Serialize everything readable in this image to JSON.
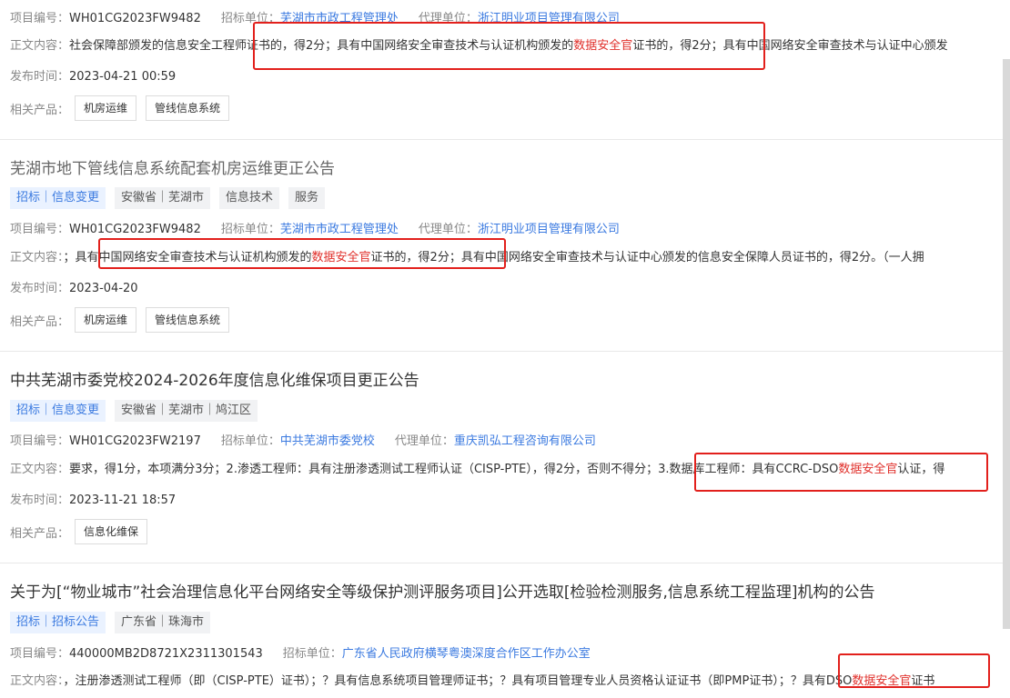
{
  "labels": {
    "project_no": "项目编号：",
    "tenderer": "招标单位：",
    "agent": "代理单位：",
    "content": "正文内容：",
    "published": "发布时间：",
    "products": "相关产品："
  },
  "highlight_term": "数据安全官",
  "items": [
    {
      "project_no": "WH01CG2023FW9482",
      "tenderer": "芜湖市市政工程管理处",
      "agent": "浙江明业项目管理有限公司",
      "content_before": "社会保障部颁发的信息安全工程师证书的，得2分；具有中国网络安全审查技术与认证机构颁发的",
      "content_after": "证书的，得2分；具有中国网络安全审查技术与认证中心颁发",
      "published": "2023-04-21 00:59",
      "products": [
        "机房运维",
        "管线信息系统"
      ]
    },
    {
      "title": "芜湖市地下管线信息系统配套机房运维更正公告",
      "tags": [
        "招标｜信息变更",
        "安徽省｜芜湖市",
        "信息技术",
        "服务"
      ],
      "project_no": "WH01CG2023FW9482",
      "tenderer": "芜湖市市政工程管理处",
      "agent": "浙江明业项目管理有限公司",
      "content_before": "；具有中国网络安全审查技术与认证机构颁发的",
      "content_after": "证书的，得2分；具有中国网络安全审查技术与认证中心颁发的信息安全保障人员证书的，得2分。（一人拥",
      "published": "2023-04-20",
      "products": [
        "机房运维",
        "管线信息系统"
      ]
    },
    {
      "title": "中共芜湖市委党校2024-2026年度信息化维保项目更正公告",
      "tags": [
        "招标｜信息变更",
        "安徽省｜芜湖市｜鸠江区"
      ],
      "project_no": "WH01CG2023FW2197",
      "tenderer": "中共芜湖市委党校",
      "agent": "重庆凯弘工程咨询有限公司",
      "content_before": "要求，得1分，本项满分3分；2.渗透工程师：具有注册渗透测试工程师认证（CISP-PTE），得2分，否则不得分；3.数据库工程师：具有CCRC-DSO",
      "content_after": "认证，得",
      "published": "2023-11-21 18:57",
      "products": [
        "信息化维保"
      ]
    },
    {
      "title": "关于为[“物业城市”社会治理信息化平台网络安全等级保护测评服务项目]公开选取[检验检测服务,信息系统工程监理]机构的公告",
      "tags": [
        "招标｜招标公告",
        "广东省｜珠海市"
      ],
      "project_no": "440000MB2D8721X2311301543",
      "tenderer": "广东省人民政府横琴粤澳深度合作区工作办公室",
      "content_before": "，注册渗透测试工程师（即（CISP-PTE）证书）；？具有信息系统项目管理师证书；？具有项目管理专业人员资格认证证书（即PMP证书）；？具有DSO",
      "content_after": "证书"
    }
  ]
}
